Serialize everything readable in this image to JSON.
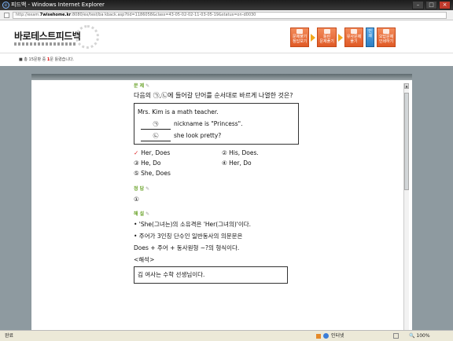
{
  "window": {
    "title": "피드백 - Windows Internet Explorer",
    "controls": {
      "minimize": "–",
      "maximize": "□",
      "close": "×"
    }
  },
  "address": {
    "prefix": "http://exam.",
    "domain": "7wisehome.kr",
    "rest": ":8080/ex/test/ba  kback.asp?tid=1186058&class=43-05-02-02-11-03-05-19&status=on-d0030"
  },
  "header": {
    "logo": "바로테스트피드백",
    "nav": [
      {
        "label1": "문제풀기",
        "label2": "정답보기"
      },
      {
        "label1": "틀린",
        "label2": "문제풀기"
      },
      {
        "label1": "유사문제",
        "label2": "풀기"
      },
      {
        "label1": "인",
        "label2": "쇄"
      },
      {
        "label1": "오답문제",
        "label2": "인쇄하기"
      }
    ],
    "notice_pre": "총 15문항 중 ",
    "notice_num": "1",
    "notice_post": "문 틀렸습니다."
  },
  "question": {
    "tag_problem": "문 제",
    "text": "다음의 ㉠,㉡에 들어갈 단어를 순서대로 바르게 나열한 것은?",
    "box_line1": "Mrs. Kim is a math teacher.",
    "box_blank1": "㉠",
    "box_line2": "nickname is \"Princess\".",
    "box_blank2": "㉡",
    "box_line3": "she look pretty?",
    "choices": [
      {
        "num": "①",
        "text": "Her, Does",
        "checked": true
      },
      {
        "num": "②",
        "text": "His, Does.",
        "checked": false
      },
      {
        "num": "③",
        "text": "He, Do",
        "checked": false
      },
      {
        "num": "④",
        "text": "Her, Do",
        "checked": false
      },
      {
        "num": "⑤",
        "text": "She, Does",
        "checked": false
      }
    ],
    "check_mark": "✓",
    "tag_answer": "정 답",
    "answer": "①",
    "tag_explain": "해 설",
    "expl1": "• 'She(그녀는)의 소유격은 'Her(그녀의)'이다.",
    "expl2": "• 주어가 3인칭 단수인 일반동사의 의문문은",
    "expl3": "Does + 주어 + 동사원형 ~?의 형식이다.",
    "expl4": "<해석>",
    "trans1": "김 여사는 수학 선생님이다."
  },
  "status": {
    "left": "완료",
    "zone": "인터넷",
    "zoom": "100%"
  }
}
